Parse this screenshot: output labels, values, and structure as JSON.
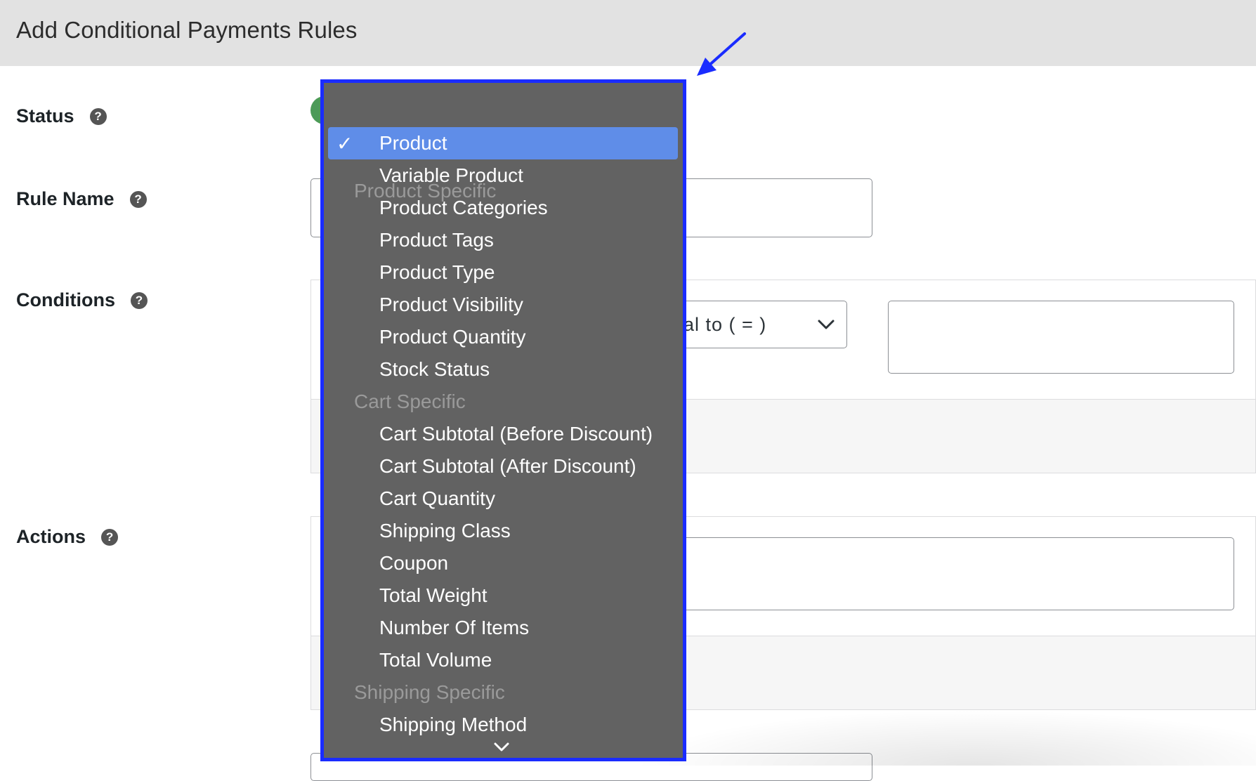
{
  "page": {
    "title": "Add Conditional Payments Rules"
  },
  "form": {
    "status_label": "Status",
    "rule_name_label": "Rule Name",
    "conditions_label": "Conditions",
    "actions_label": "Actions",
    "help_glyph": "?",
    "condition_operator_value": "al to ( = )",
    "rule_name_value": "",
    "condition_value": "",
    "action_value": ""
  },
  "dropdown": {
    "groups": [
      {
        "label": "Product Specific",
        "items": [
          "Product",
          "Variable Product",
          "Product Categories",
          "Product Tags",
          "Product Type",
          "Product Visibility",
          "Product Quantity",
          "Stock Status"
        ]
      },
      {
        "label": "Cart Specific",
        "items": [
          "Cart Subtotal (Before Discount)",
          "Cart Subtotal (After Discount)",
          "Cart Quantity",
          "Shipping Class",
          "Coupon",
          "Total Weight",
          "Number Of Items",
          "Total Volume"
        ]
      },
      {
        "label": "Shipping Specific",
        "items": [
          "Shipping Method"
        ]
      }
    ],
    "selected_item": "Product",
    "checkmark": "✓"
  },
  "colors": {
    "header_bg": "#e2e2e2",
    "dropdown_bg": "#626262",
    "dropdown_border": "#1a2cff",
    "selected_bg": "#5f8de8",
    "toggle_on": "#4c9a58",
    "annotation_arrow": "#1a2cff"
  },
  "icons": {
    "help": "question-circle-icon",
    "select_chevron": "chevron-down-icon",
    "scroll_down": "chevron-down-icon",
    "annotation": "arrow-annotation-icon",
    "check": "checkmark-icon"
  }
}
